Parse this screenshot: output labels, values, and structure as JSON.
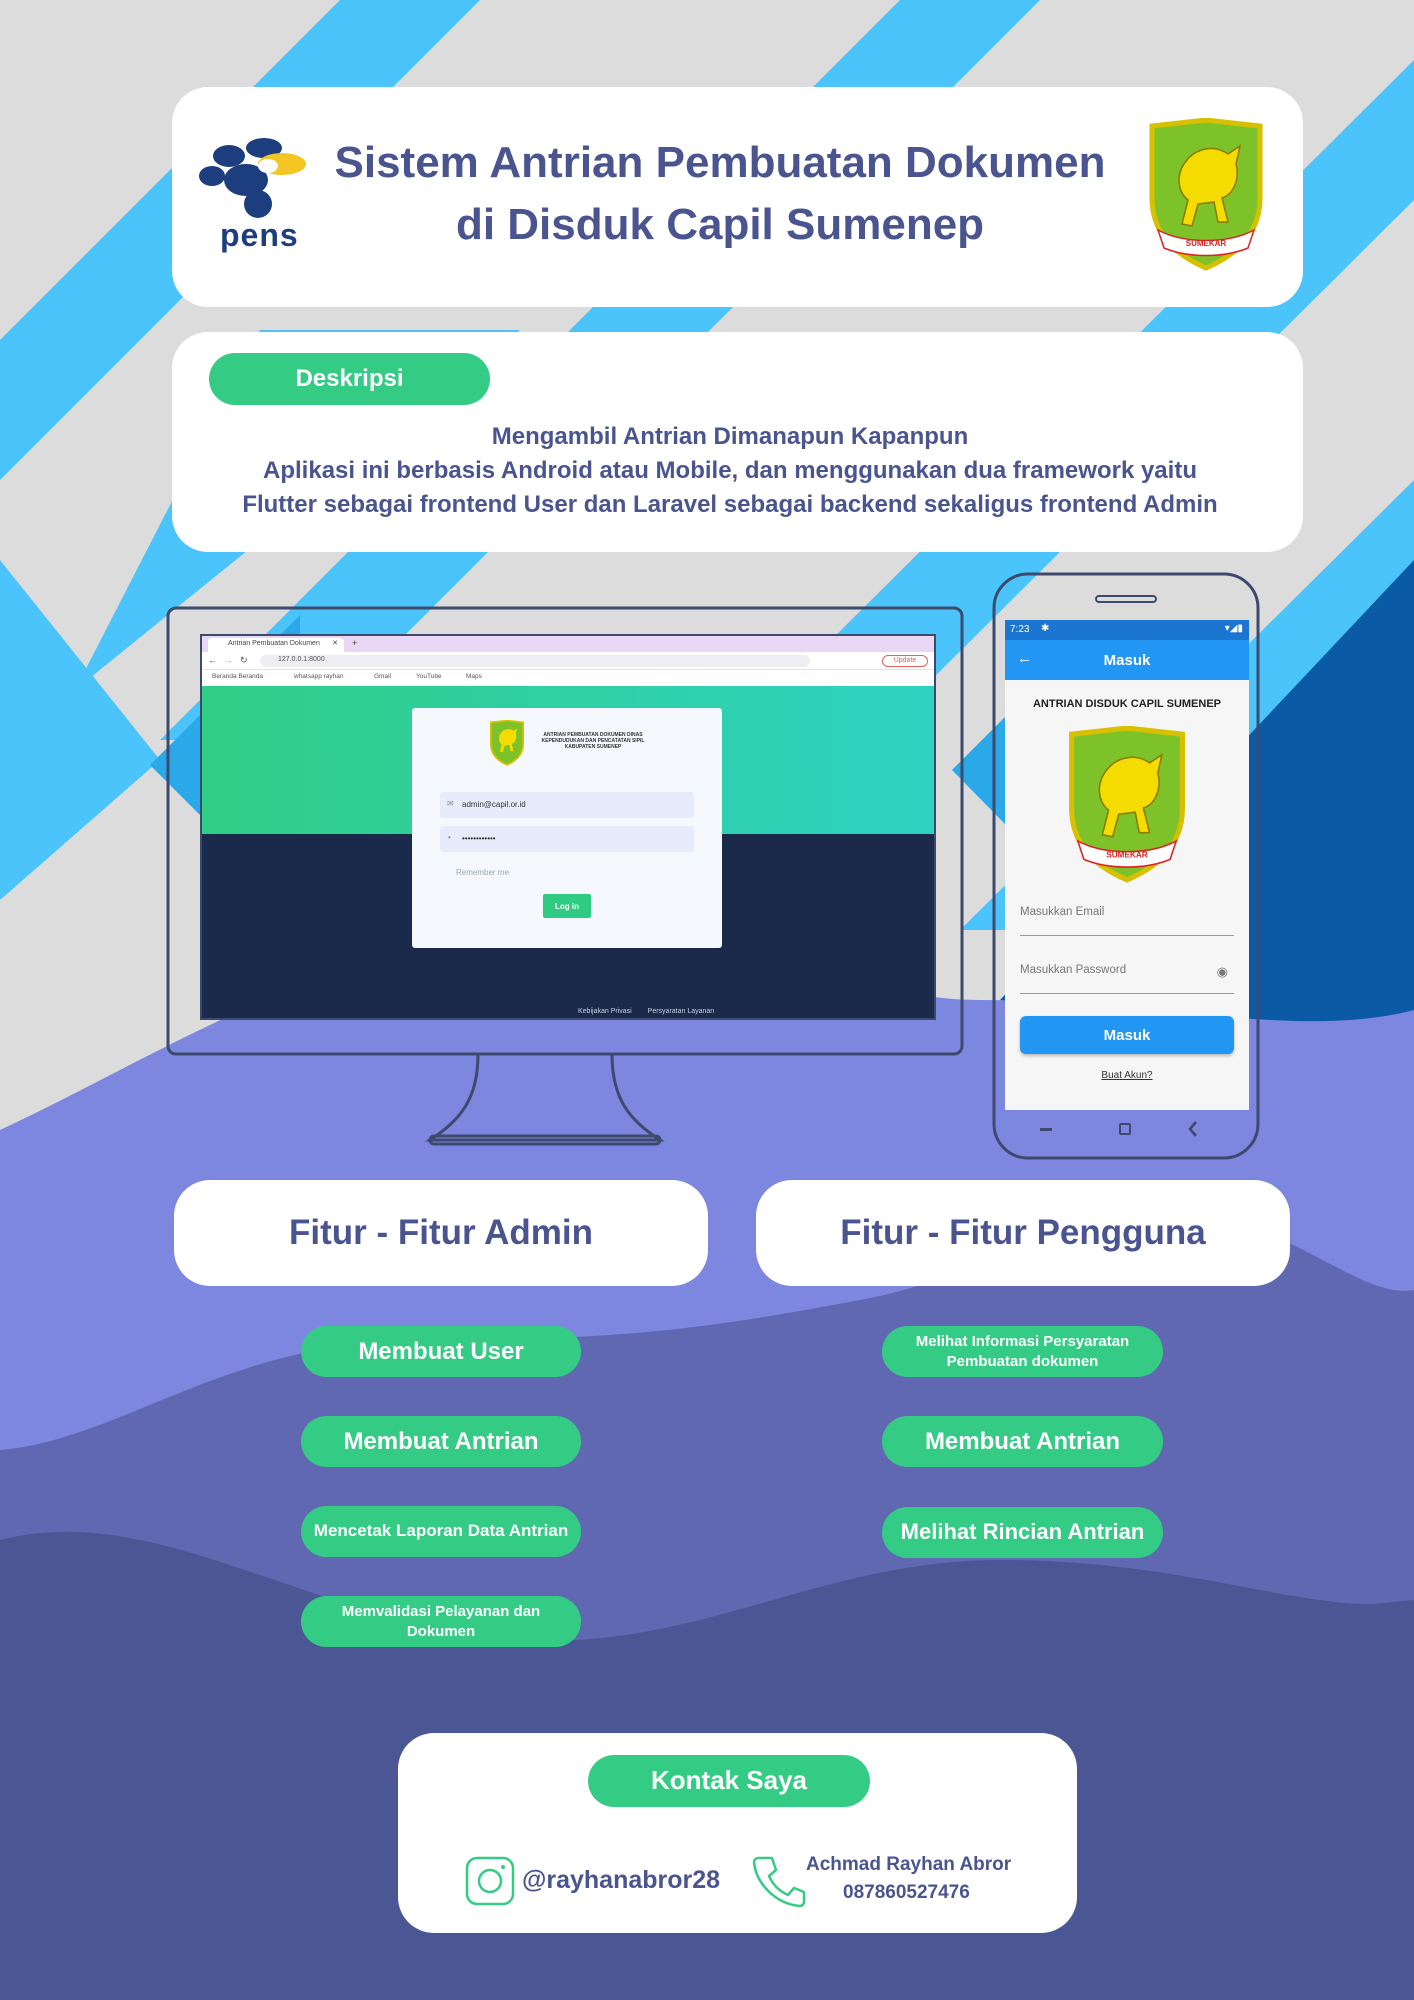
{
  "header": {
    "title_line1": "Sistem Antrian Pembuatan Dokumen",
    "title_line2": "di Disduk Capil Sumenep",
    "left_logo_text": "pens",
    "right_logo_ribbon": "SUMEKAR"
  },
  "description": {
    "badge": "Deskripsi",
    "line1": "Mengambil Antrian Dimanapun Kapanpun",
    "line2": "Aplikasi ini berbasis Android atau Mobile, dan menggunakan dua framework yaitu",
    "line3": "Flutter sebagai frontend User dan Laravel sebagai backend sekaligus frontend Admin"
  },
  "desktop_screenshot": {
    "tab_title": "Antrian Pembuatan Dokumen",
    "url": "127.0.0.1:8000",
    "update_button": "Update",
    "bookmarks": [
      "Beranda Beranda",
      "whatsapp rayhan",
      "Gmail",
      "YouTube",
      "Maps"
    ],
    "login_title": "ANTRIAN PEMBUATAN DOKUMEN DINAS KEPENDUDUKAN DAN PENCATATAN SIPIL KABUPATEN SUMENEP",
    "email_value": "admin@capil.or.id",
    "password_value": "••••••••••••",
    "remember_label": "Remember me",
    "login_button": "Log in",
    "footer_links": [
      "Kebijakan Privasi",
      "Persyaratan Layanan"
    ]
  },
  "phone_screenshot": {
    "time": "7:23",
    "appbar_title": "Masuk",
    "heading": "ANTRIAN DISDUK CAPIL SUMENEP",
    "logo_ribbon": "SUMEKAR",
    "email_placeholder": "Masukkan Email",
    "password_placeholder": "Masukkan Password",
    "login_button": "Masuk",
    "register_link": "Buat Akun?"
  },
  "features": {
    "admin_title": "Fitur - Fitur Admin",
    "user_title": "Fitur - Fitur Pengguna",
    "admin_items": [
      "Membuat User",
      "Membuat Antrian",
      "Mencetak Laporan Data Antrian",
      "Memvalidasi Pelayanan dan Dokumen"
    ],
    "user_items": [
      "Melihat Informasi Persyaratan Pembuatan dokumen",
      "Membuat Antrian",
      "Melihat Rincian Antrian"
    ]
  },
  "contact": {
    "badge": "Kontak Saya",
    "instagram": "@rayhanabror28",
    "name": "Achmad Rayhan Abror",
    "phone": "087860527476"
  },
  "colors": {
    "navy_text": "#4a5590",
    "green": "#34cc85",
    "sky_blue": "#4ac4fa",
    "lavender": "#7d87e0",
    "indigo": "#4b5694",
    "android_blue": "#2196f3"
  },
  "icons": {
    "instagram": "instagram-icon",
    "phone": "phone-icon",
    "back": "back-arrow-icon",
    "eye": "eye-icon"
  }
}
